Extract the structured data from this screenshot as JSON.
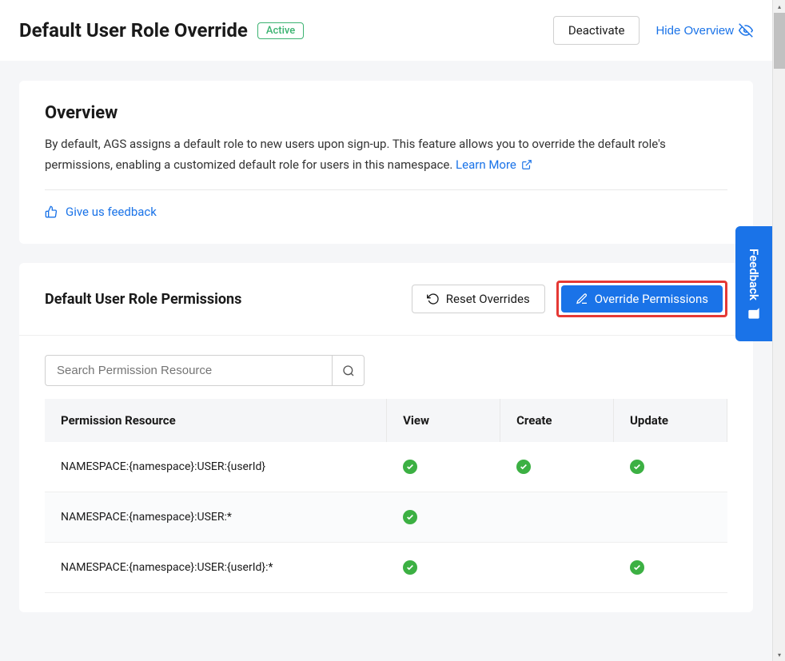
{
  "header": {
    "title": "Default User Role Override",
    "status": "Active",
    "deactivate_label": "Deactivate",
    "hide_overview_label": "Hide Overview"
  },
  "overview": {
    "title": "Overview",
    "text": "By default, AGS assigns a default role to new users upon sign-up. This feature allows you to override the default role's permissions, enabling a customized default role for users in this namespace.",
    "learn_more_label": "Learn More",
    "feedback_label": "Give us feedback"
  },
  "permissions": {
    "title": "Default User Role Permissions",
    "reset_label": "Reset Overrides",
    "override_label": "Override Permissions",
    "search_placeholder": "Search Permission Resource",
    "columns": {
      "resource": "Permission Resource",
      "view": "View",
      "create": "Create",
      "update": "Update"
    },
    "rows": [
      {
        "resource": "NAMESPACE:{namespace}:USER:{userId}",
        "view": true,
        "create": true,
        "update": true
      },
      {
        "resource": "NAMESPACE:{namespace}:USER:*",
        "view": true,
        "create": false,
        "update": false
      },
      {
        "resource": "NAMESPACE:{namespace}:USER:{userId}:*",
        "view": true,
        "create": false,
        "update": true
      }
    ]
  },
  "feedback_tab": "Feedback"
}
